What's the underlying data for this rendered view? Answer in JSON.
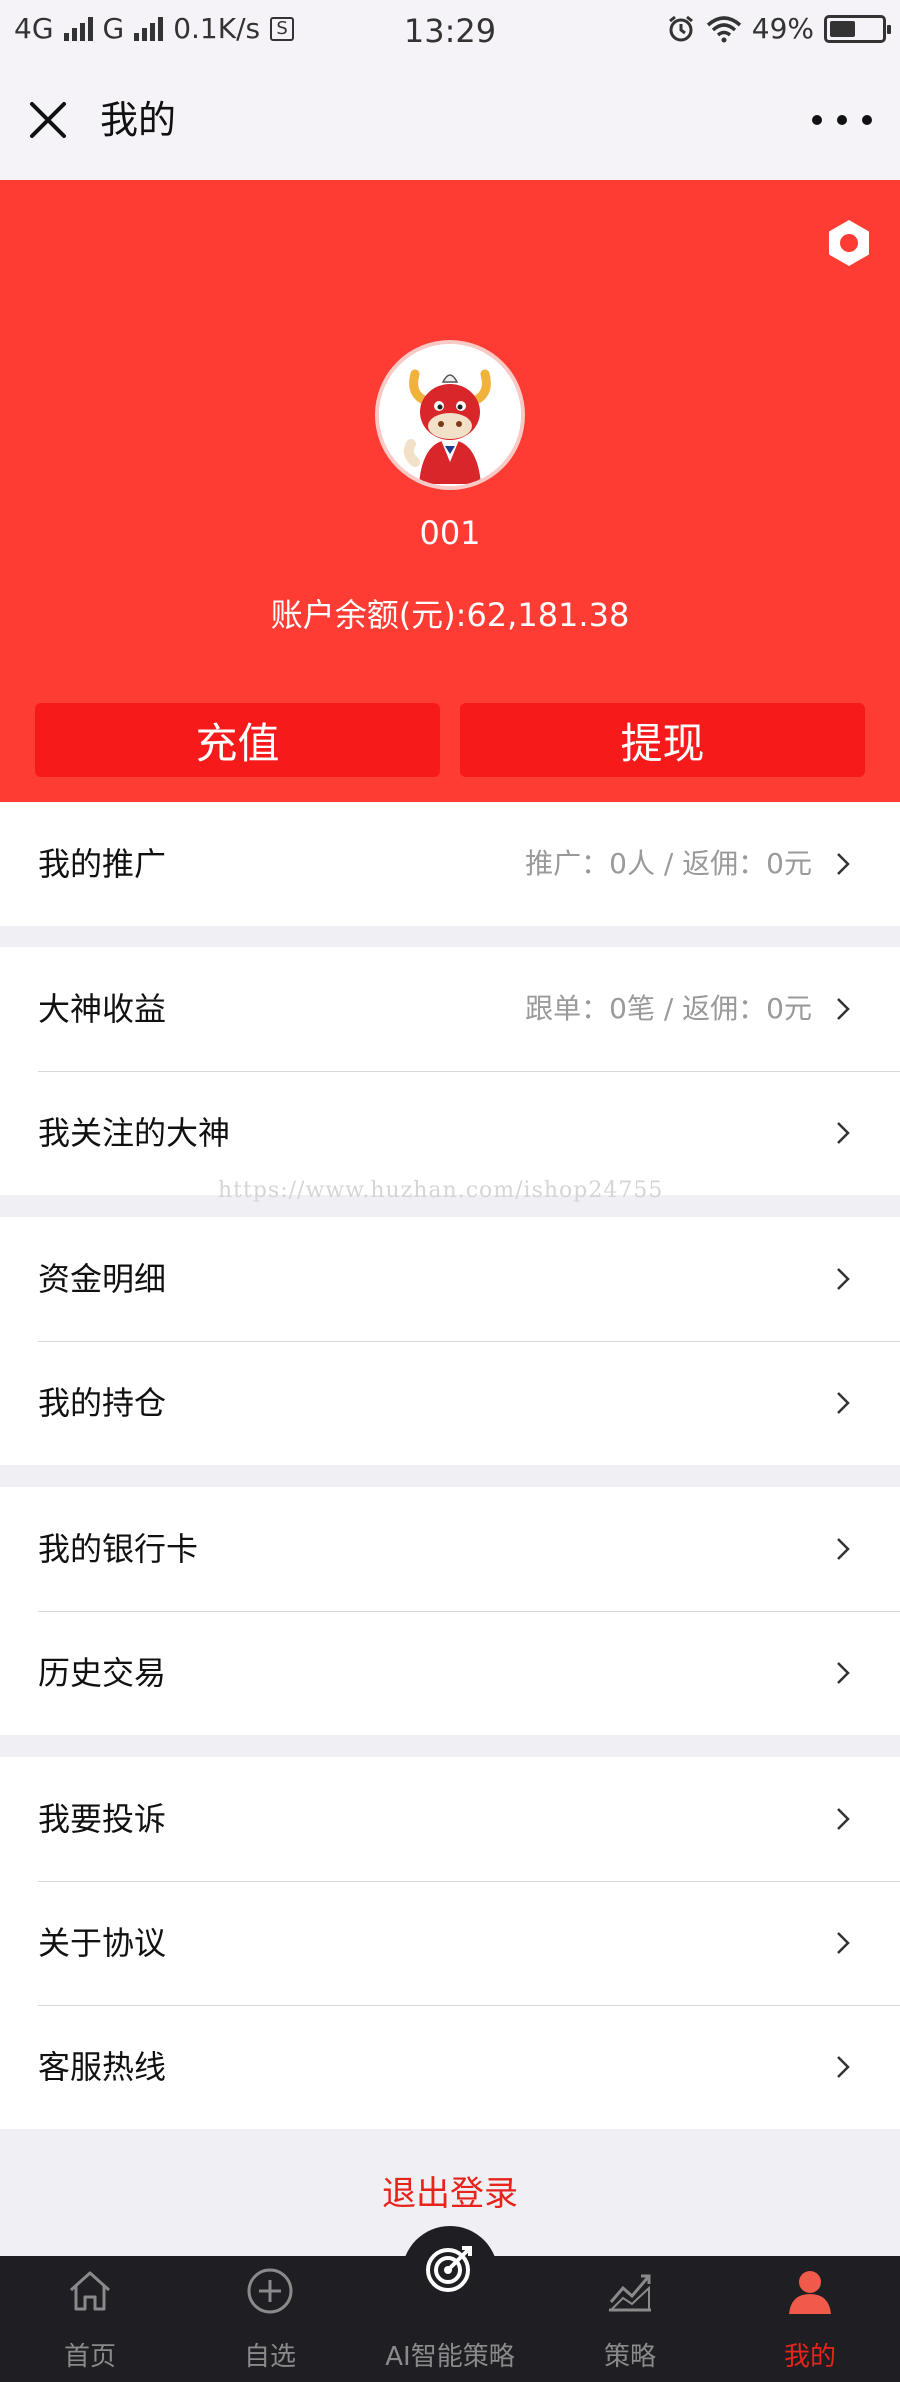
{
  "status_bar": {
    "network_1": "4G",
    "network_2": "G",
    "speed": "0.1K/s",
    "s_badge": "S",
    "time": "13:29",
    "battery_level": 0.49,
    "battery_text": "49%",
    "icons": [
      "signal-icon",
      "signal-icon",
      "alarm-icon",
      "wifi-icon",
      "battery-icon"
    ]
  },
  "nav": {
    "title": "我的",
    "close_icon": "close-icon",
    "more_icon": "more-icon"
  },
  "profile": {
    "username": "001",
    "balance": "账户余额(元):62,181.38",
    "recharge_label": "充值",
    "withdraw_label": "提现",
    "settings_icon": "gear-icon",
    "accent_color": "#fe3c33",
    "button_color": "#f61a1a"
  },
  "menu": {
    "promotion": {
      "label": "我的推广",
      "meta": "推广：0人 / 返佣：0元"
    },
    "master_income": {
      "label": "大神收益",
      "meta": "跟单：0笔 / 返佣：0元"
    },
    "followed_masters": {
      "label": "我关注的大神"
    },
    "fund_details": {
      "label": "资金明细"
    },
    "positions": {
      "label": "我的持仓"
    },
    "bank_cards": {
      "label": "我的银行卡"
    },
    "history": {
      "label": "历史交易"
    },
    "complaint": {
      "label": "我要投诉"
    },
    "agreement": {
      "label": "关于协议"
    },
    "hotline": {
      "label": "客服热线"
    }
  },
  "watermark": "https://www.huzhan.com/ishop24755",
  "logout_label": "退出登录",
  "tabbar": {
    "items": [
      {
        "label": "首页",
        "icon": "home-icon"
      },
      {
        "label": "自选",
        "icon": "add-circle-icon"
      },
      {
        "label": "AI智能策略",
        "icon": "target-icon"
      },
      {
        "label": "策略",
        "icon": "chart-icon"
      },
      {
        "label": "我的",
        "icon": "user-icon",
        "active": true
      }
    ],
    "active_color": "#e8231c"
  }
}
